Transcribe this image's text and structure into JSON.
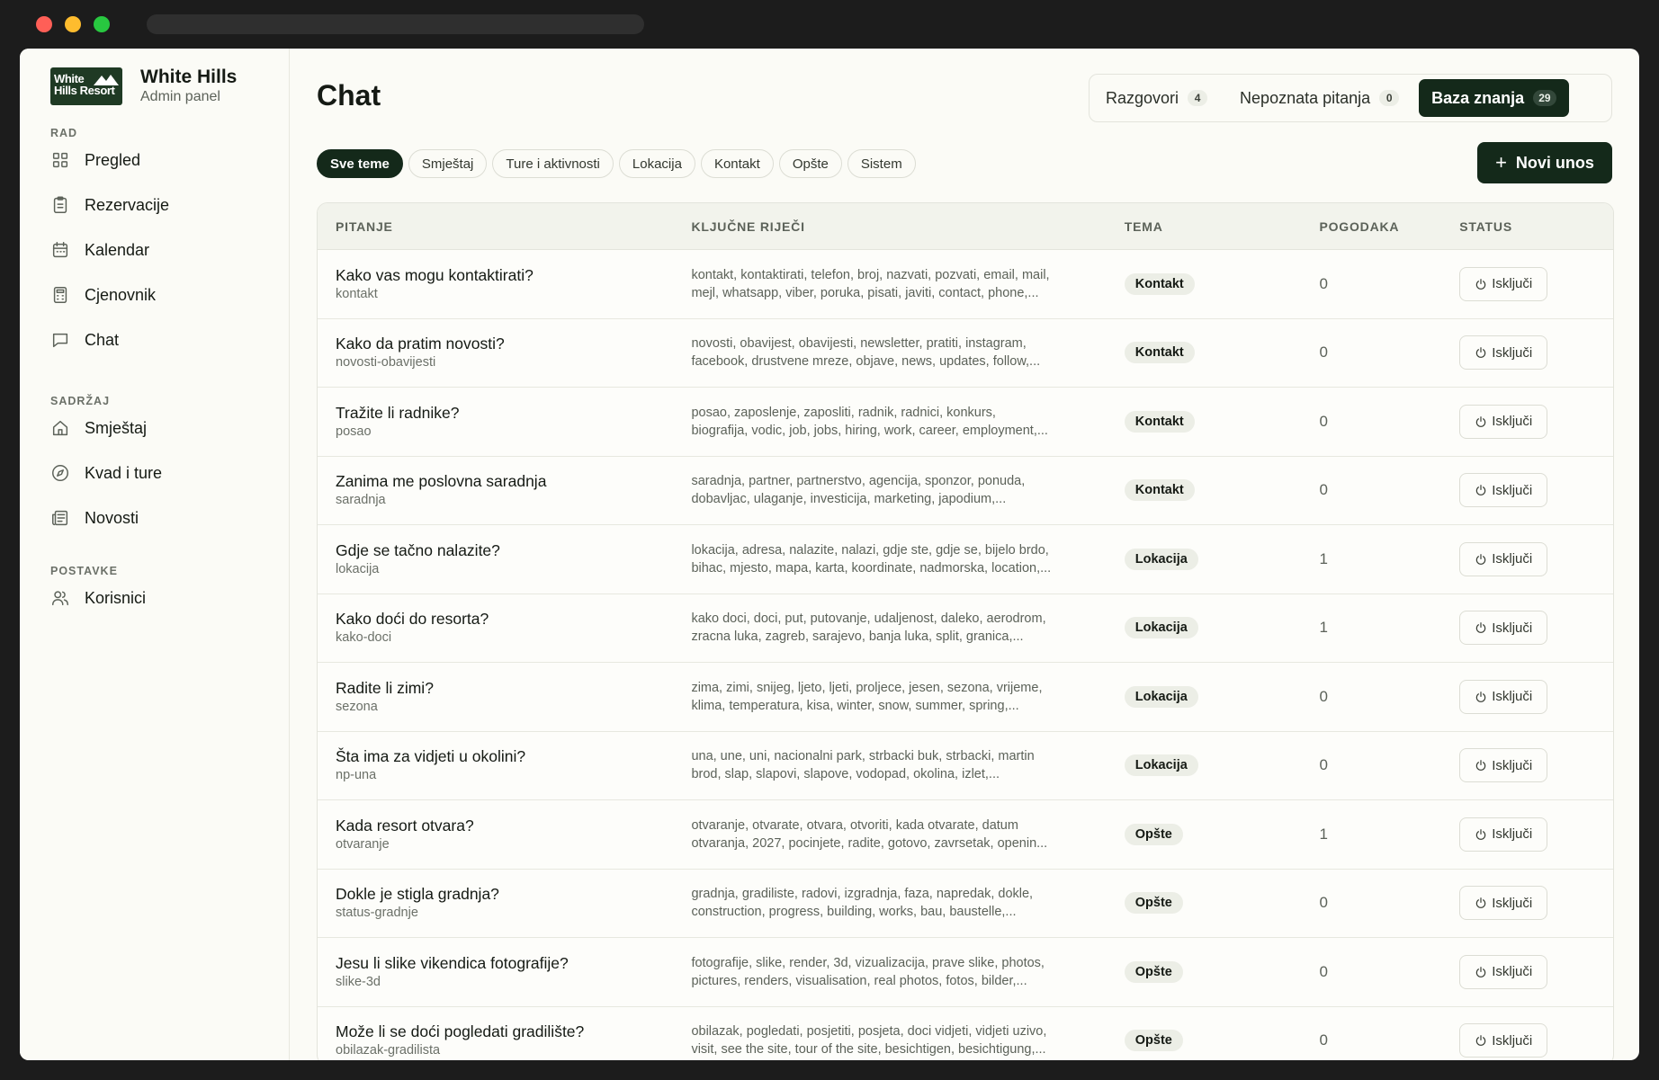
{
  "brand": {
    "logo_line1": "White",
    "logo_line2": "Hills Resort",
    "title": "White Hills",
    "subtitle": "Admin panel"
  },
  "sidebar": {
    "sections": [
      {
        "label": "RAD",
        "items": [
          {
            "label": "Pregled",
            "icon": "grid-icon"
          },
          {
            "label": "Rezervacije",
            "icon": "clipboard-icon"
          },
          {
            "label": "Kalendar",
            "icon": "calendar-icon"
          },
          {
            "label": "Cjenovnik",
            "icon": "calculator-icon"
          },
          {
            "label": "Chat",
            "icon": "chat-icon"
          }
        ]
      },
      {
        "label": "SADRŽAJ",
        "items": [
          {
            "label": "Smještaj",
            "icon": "home-icon"
          },
          {
            "label": "Kvad i ture",
            "icon": "compass-icon"
          },
          {
            "label": "Novosti",
            "icon": "newspaper-icon"
          }
        ]
      },
      {
        "label": "POSTAVKE",
        "items": [
          {
            "label": "Korisnici",
            "icon": "users-icon"
          }
        ]
      }
    ]
  },
  "page": {
    "title": "Chat"
  },
  "tabs": [
    {
      "label": "Razgovori",
      "count": "4",
      "active": false
    },
    {
      "label": "Nepoznata pitanja",
      "count": "0",
      "active": false
    },
    {
      "label": "Baza znanja",
      "count": "29",
      "active": true
    }
  ],
  "filters": [
    "Sve teme",
    "Smještaj",
    "Ture i aktivnosti",
    "Lokacija",
    "Kontakt",
    "Opšte",
    "Sistem"
  ],
  "new_button": {
    "label": "Novi unos"
  },
  "table": {
    "headers": [
      "PITANJE",
      "KLJUČNE RIJEČI",
      "TEMA",
      "POGODAKA",
      "STATUS"
    ],
    "rows": [
      {
        "question": "Kako vas mogu kontaktirati?",
        "slug": "kontakt",
        "kw1": "kontakt, kontaktirati, telefon, broj, nazvati, pozvati, email, mail,",
        "kw2": "mejl, whatsapp, viber, poruka, pisati, javiti, contact, phone,...",
        "topic": "Kontakt",
        "hits": "0",
        "status": "Isključi"
      },
      {
        "question": "Kako da pratim novosti?",
        "slug": "novosti-obavijesti",
        "kw1": "novosti, obavijest, obavijesti, newsletter, pratiti, instagram,",
        "kw2": "facebook, drustvene mreze, objave, news, updates, follow,...",
        "topic": "Kontakt",
        "hits": "0",
        "status": "Isključi"
      },
      {
        "question": "Tražite li radnike?",
        "slug": "posao",
        "kw1": "posao, zaposlenje, zaposliti, radnik, radnici, konkurs,",
        "kw2": "biografija, vodic, job, jobs, hiring, work, career, employment,...",
        "topic": "Kontakt",
        "hits": "0",
        "status": "Isključi"
      },
      {
        "question": "Zanima me poslovna saradnja",
        "slug": "saradnja",
        "kw1": "saradnja, partner, partnerstvo, agencija, sponzor, ponuda,",
        "kw2": "dobavljac, ulaganje, investicija, marketing, japodium,...",
        "topic": "Kontakt",
        "hits": "0",
        "status": "Isključi"
      },
      {
        "question": "Gdje se tačno nalazite?",
        "slug": "lokacija",
        "kw1": "lokacija, adresa, nalazite, nalazi, gdje ste, gdje se, bijelo brdo,",
        "kw2": "bihac, mjesto, mapa, karta, koordinate, nadmorska, location,...",
        "topic": "Lokacija",
        "hits": "1",
        "status": "Isključi"
      },
      {
        "question": "Kako doći do resorta?",
        "slug": "kako-doci",
        "kw1": "kako doci, doci, put, putovanje, udaljenost, daleko, aerodrom,",
        "kw2": "zracna luka, zagreb, sarajevo, banja luka, split, granica,...",
        "topic": "Lokacija",
        "hits": "1",
        "status": "Isključi"
      },
      {
        "question": "Radite li zimi?",
        "slug": "sezona",
        "kw1": "zima, zimi, snijeg, ljeto, ljeti, proljece, jesen, sezona, vrijeme,",
        "kw2": "klima, temperatura, kisa, winter, snow, summer, spring,...",
        "topic": "Lokacija",
        "hits": "0",
        "status": "Isključi"
      },
      {
        "question": "Šta ima za vidjeti u okolini?",
        "slug": "np-una",
        "kw1": "una, une, uni, nacionalni park, strbacki buk, strbacki, martin",
        "kw2": "brod, slap, slapovi, slapove, vodopad, okolina, izlet,...",
        "topic": "Lokacija",
        "hits": "0",
        "status": "Isključi"
      },
      {
        "question": "Kada resort otvara?",
        "slug": "otvaranje",
        "kw1": "otvaranje, otvarate, otvara, otvoriti, kada otvarate, datum",
        "kw2": "otvaranja, 2027, pocinjete, radite, gotovo, zavrsetak, openin...",
        "topic": "Opšte",
        "hits": "1",
        "status": "Isključi"
      },
      {
        "question": "Dokle je stigla gradnja?",
        "slug": "status-gradnje",
        "kw1": "gradnja, gradiliste, radovi, izgradnja, faza, napredak, dokle,",
        "kw2": "construction, progress, building, works, bau, baustelle,...",
        "topic": "Opšte",
        "hits": "0",
        "status": "Isključi"
      },
      {
        "question": "Jesu li slike vikendica fotografije?",
        "slug": "slike-3d",
        "kw1": "fotografije, slike, render, 3d, vizualizacija, prave slike, photos,",
        "kw2": "pictures, renders, visualisation, real photos, fotos, bilder,...",
        "topic": "Opšte",
        "hits": "0",
        "status": "Isključi"
      },
      {
        "question": "Može li se doći pogledati gradilište?",
        "slug": "obilazak-gradilista",
        "kw1": "obilazak, pogledati, posjetiti, posjeta, doci vidjeti, vidjeti uzivo,",
        "kw2": "visit, see the site, tour of the site, besichtigen, besichtigung,...",
        "topic": "Opšte",
        "hits": "0",
        "status": "Isključi"
      }
    ]
  }
}
